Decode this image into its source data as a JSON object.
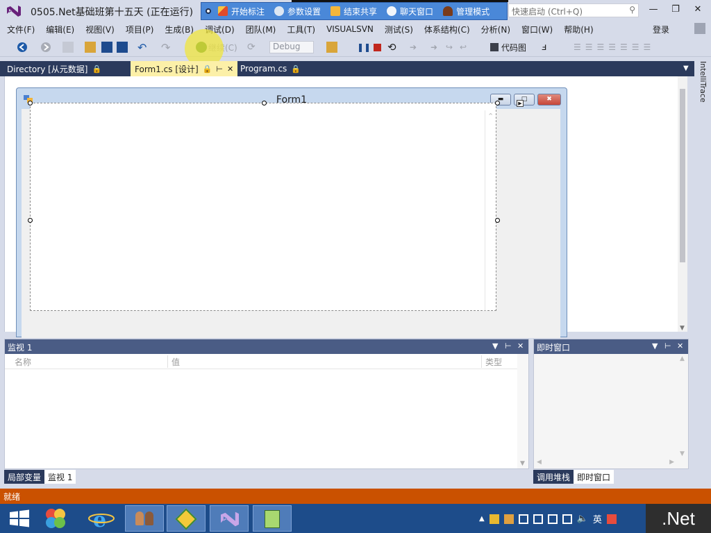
{
  "window": {
    "title": "0505.Net基础班第十五天 (正在运行)",
    "quick_launch_placeholder": "快速启动 (Ctrl+Q)"
  },
  "recorder_toolbar": {
    "items": [
      {
        "label": "开始标注",
        "icon": "pen-icon"
      },
      {
        "label": "参数设置",
        "icon": "settings-icon"
      },
      {
        "label": "结束共享",
        "icon": "stop-share-icon"
      },
      {
        "label": "聊天窗口",
        "icon": "chat-icon"
      },
      {
        "label": "管理模式",
        "icon": "admin-icon"
      }
    ]
  },
  "menubar": {
    "items": [
      "文件(F)",
      "编辑(E)",
      "视图(V)",
      "项目(P)",
      "生成(B)",
      "调试(D)",
      "团队(M)",
      "工具(T)",
      "VISUALSVN",
      "测试(S)",
      "体系结构(C)",
      "分析(N)",
      "窗口(W)",
      "帮助(H)"
    ],
    "login": "登录"
  },
  "toolbar": {
    "continue_label": "继续(C)",
    "config_value": "Debug",
    "code_map_label": "代码图"
  },
  "doc_tabs": [
    {
      "label": "Directory [从元数据]",
      "active": false
    },
    {
      "label": "Form1.cs [设计]",
      "active": true
    },
    {
      "label": "Program.cs",
      "active": false
    }
  ],
  "side_panel": {
    "label": "IntelliTrace"
  },
  "designer": {
    "form_title": "Form1"
  },
  "watch_panel": {
    "title": "监视 1",
    "columns": [
      "名称",
      "值",
      "类型"
    ]
  },
  "immediate_panel": {
    "title": "即时窗口"
  },
  "bottom_tabs_left": [
    "局部变量",
    "监视 1"
  ],
  "bottom_tabs_right": [
    "调用堆栈",
    "即时窗口"
  ],
  "status": {
    "text": "就绪"
  },
  "taskbar": {
    "tray_ime": "英",
    "brand_badge": ".Net"
  },
  "colors": {
    "accent_status": "#ca5100",
    "active_tab": "#fcf0a8",
    "tab_strip": "#2b3a5c",
    "panel_header": "#4a5c85",
    "recorder_bar": "#4a88d8"
  }
}
